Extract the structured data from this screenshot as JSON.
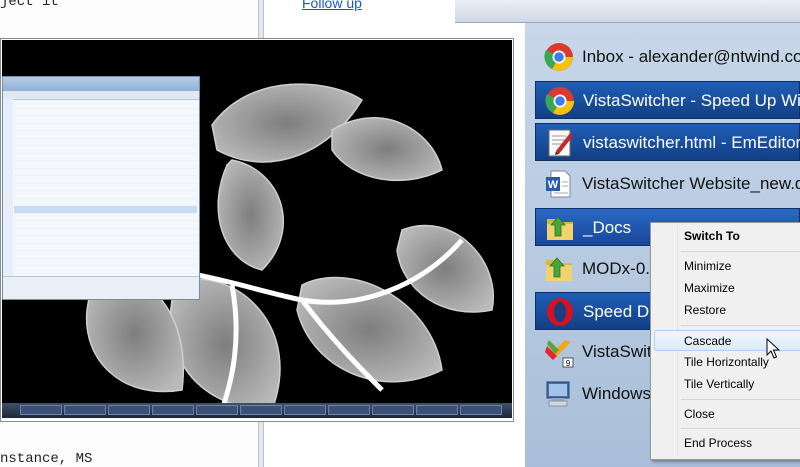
{
  "editor": {
    "lines": [
      "ject it",
      "",
      "",
      "",
      "",
      "",
      "",
      "",
      "",
      "",
      "",
      "",
      "",
      "",
      "",
      "",
      "",
      "",
      "",
      "",
      "",
      "",
      "",
      "",
      "",
      "",
      "",
      "",
      "nstance, MS"
    ]
  },
  "browser": {
    "link": "Follow up"
  },
  "switcher": {
    "items": [
      {
        "label": "Inbox - alexander@ntwind.com",
        "icon": "chrome-icon",
        "state": "normal"
      },
      {
        "label": "VistaSwitcher - Speed Up Wi",
        "icon": "chrome-icon",
        "state": "selected"
      },
      {
        "label": "vistaswitcher.html - EmEditor",
        "icon": "emeditor-icon",
        "state": "selected"
      },
      {
        "label": "VistaSwitcher Website_new.d",
        "icon": "word-icon",
        "state": "normal"
      },
      {
        "label": "_Docs",
        "icon": "folder-icon",
        "state": "hover"
      },
      {
        "label": "MODx-0.",
        "icon": "folder-icon",
        "state": "normal"
      },
      {
        "label": "Speed Di",
        "icon": "opera-icon",
        "state": "selected"
      },
      {
        "label": "VistaSwit",
        "icon": "vistaswitcher-icon",
        "state": "normal"
      },
      {
        "label": "Windows",
        "icon": "windows-icon",
        "state": "normal"
      }
    ]
  },
  "context_menu": {
    "header": "Switch To",
    "items": [
      "Minimize",
      "Maximize",
      "Restore",
      "Cascade",
      "Tile Horizontally",
      "Tile Vertically",
      "Close",
      "End Process"
    ],
    "highlighted": "Cascade"
  },
  "colors": {
    "selection": "#1f5eb6",
    "menu_bg": "#f0f0f0",
    "highlight_border": "#aecff7"
  }
}
